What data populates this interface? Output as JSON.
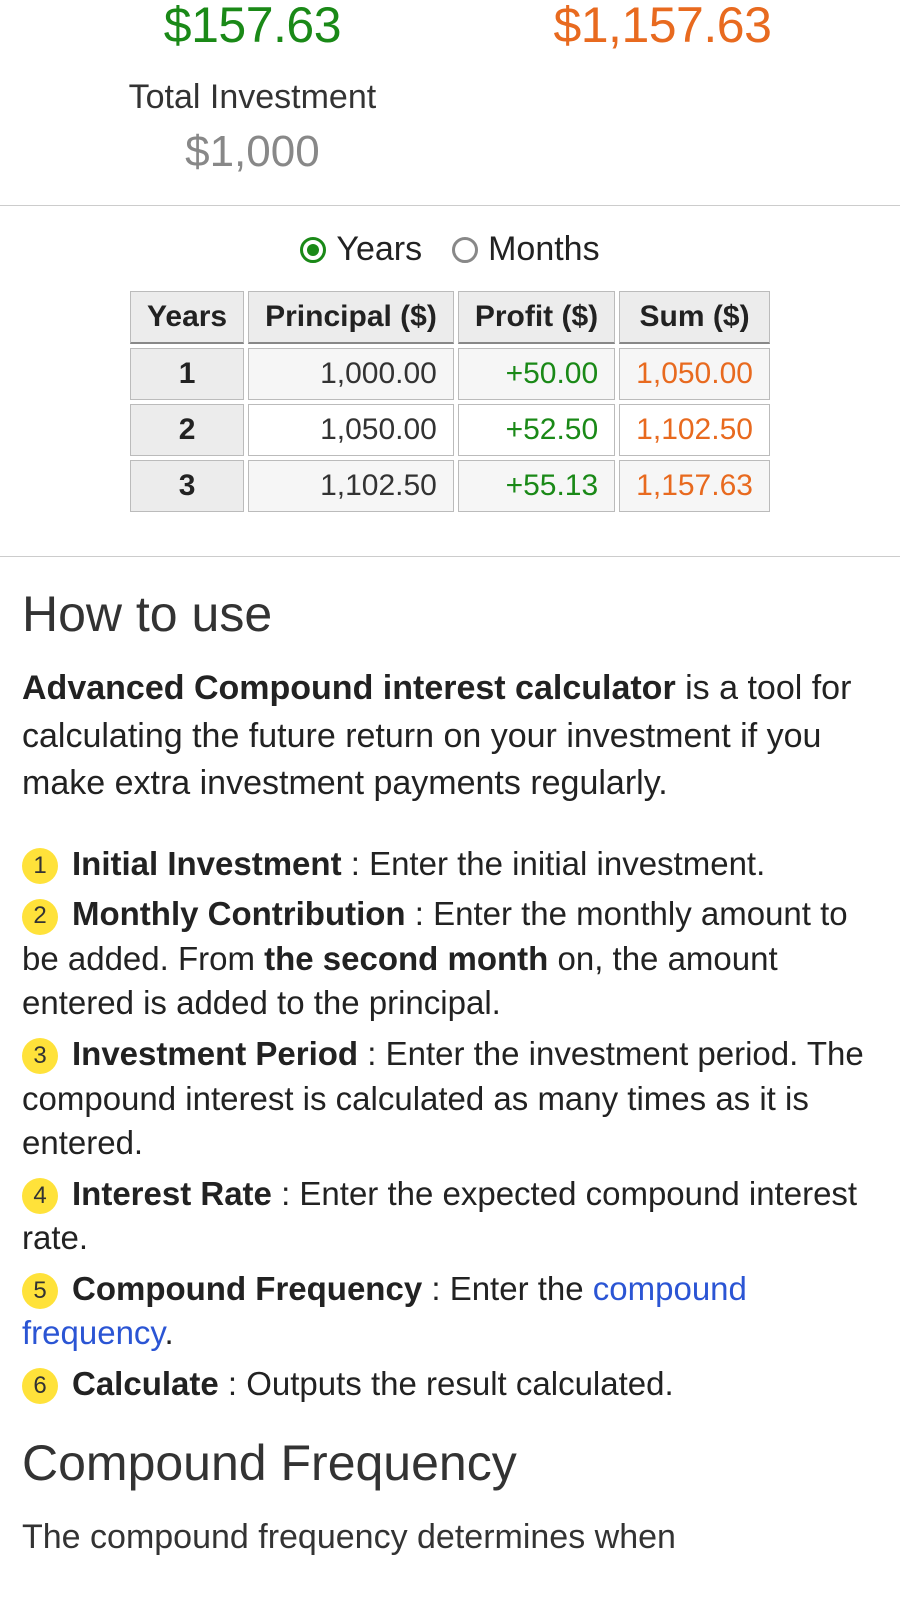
{
  "summary": {
    "left_value": "$157.63",
    "right_value": "$1,157.63",
    "sub_label": "Total Investment",
    "sub_value": "$1,000"
  },
  "periodToggle": {
    "years": "Years",
    "months": "Months",
    "selected": "years"
  },
  "table": {
    "headers": {
      "period": "Years",
      "principal": "Principal ($)",
      "profit": "Profit ($)",
      "sum": "Sum ($)"
    },
    "rows": [
      {
        "period": "1",
        "principal": "1,000.00",
        "profit": "+50.00",
        "sum": "1,050.00"
      },
      {
        "period": "2",
        "principal": "1,050.00",
        "profit": "+52.50",
        "sum": "1,102.50"
      },
      {
        "period": "3",
        "principal": "1,102.50",
        "profit": "+55.13",
        "sum": "1,157.63"
      }
    ]
  },
  "howto": {
    "title": "How to use",
    "intro_bold": "Advanced Compound interest calculator",
    "intro_rest": " is a tool for calculating the future return on your investment if you make extra investment payments regularly.",
    "steps": [
      {
        "n": "1",
        "term": "Initial Investment",
        "body": " : Enter the initial investment."
      },
      {
        "n": "2",
        "term": "Monthly Contribution",
        "body_pre": " : Enter the monthly amount to be added. From ",
        "emphasis": "the second month",
        "body_post": " on, the amount entered is added to the principal."
      },
      {
        "n": "3",
        "term": "Investment Period",
        "body": " : Enter the investment period. The compound interest is calculated as many times as it is entered."
      },
      {
        "n": "4",
        "term": "Interest Rate",
        "body": " : Enter the expected compound interest rate."
      },
      {
        "n": "5",
        "term": "Compound Frequency",
        "body_pre": " : Enter the ",
        "link": "compound frequency",
        "body_post": "."
      },
      {
        "n": "6",
        "term": "Calculate",
        "body": " : Outputs the result calculated."
      }
    ]
  },
  "compoundFreq": {
    "title": "Compound Frequency",
    "truncated": "The compound frequency determines when"
  }
}
